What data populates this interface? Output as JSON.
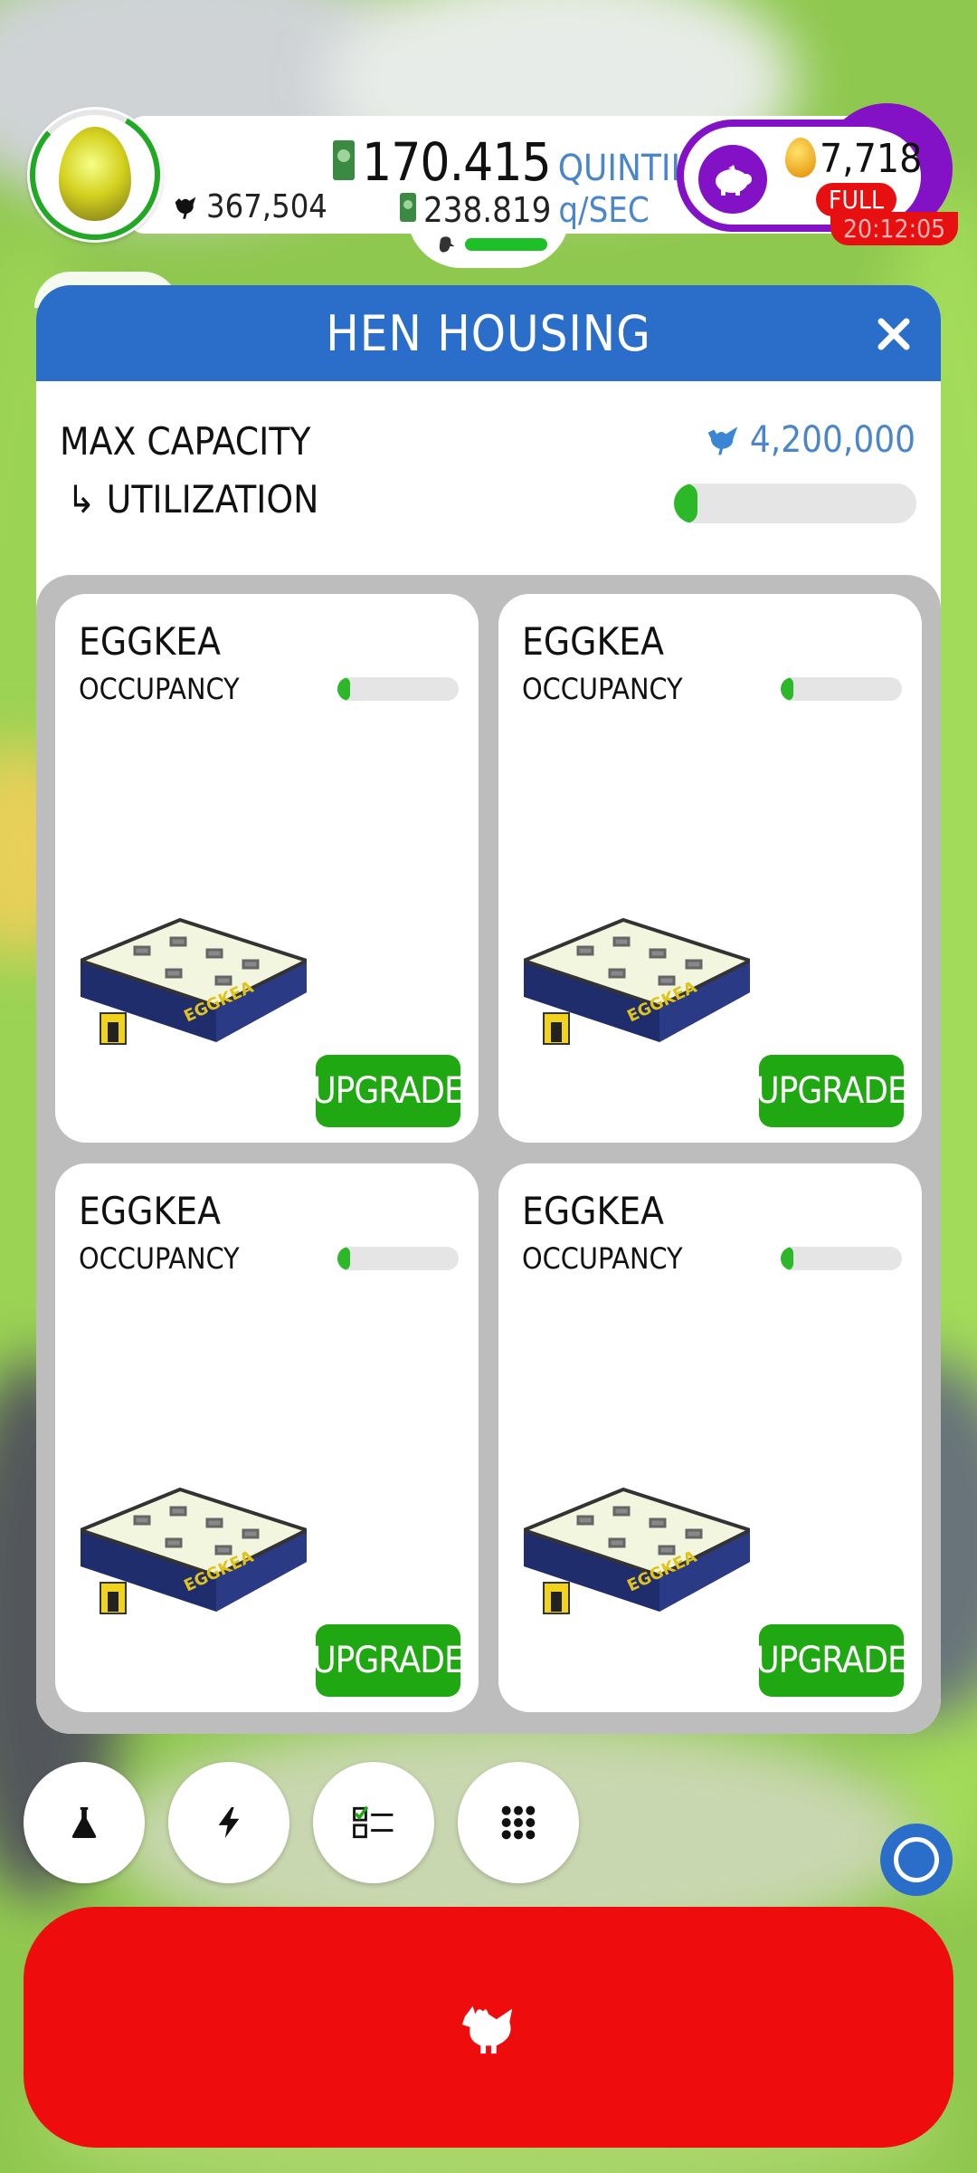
{
  "hud": {
    "chicken_count": "367,504",
    "money_amount": "170.415",
    "money_unit": "QUINTILLION",
    "rate_amount": "238.819",
    "rate_unit": "q/SEC",
    "golden_eggs": "7,718",
    "piggy_status": "FULL",
    "timer": "20:12:05"
  },
  "panel": {
    "title": "HEN HOUSING",
    "max_capacity_label": "MAX CAPACITY",
    "utilization_label": "↳ UTILIZATION",
    "max_capacity_value": "4,200,000",
    "utilization_fraction": 0.06
  },
  "houses": [
    {
      "name": "EGGKEA",
      "occupancy_label": "OCCUPANCY",
      "occupancy_fraction": 0.06,
      "upgrade_label": "UPGRADE"
    },
    {
      "name": "EGGKEA",
      "occupancy_label": "OCCUPANCY",
      "occupancy_fraction": 0.06,
      "upgrade_label": "UPGRADE"
    },
    {
      "name": "EGGKEA",
      "occupancy_label": "OCCUPANCY",
      "occupancy_fraction": 0.06,
      "upgrade_label": "UPGRADE"
    },
    {
      "name": "EGGKEA",
      "occupancy_label": "OCCUPANCY",
      "occupancy_fraction": 0.06,
      "upgrade_label": "UPGRADE"
    }
  ],
  "building_sign": "EGGKEA",
  "bottom_buttons": [
    {
      "icon": "flask-icon"
    },
    {
      "icon": "lightning-icon"
    },
    {
      "icon": "checklist-icon"
    },
    {
      "icon": "grid-menu-icon"
    }
  ],
  "colors": {
    "header_blue": "#2b6ec9",
    "upgrade_green": "#1fa812",
    "hatch_red": "#ef0c0c",
    "piggy_purple": "#8311c6",
    "accent_blue_text": "#4a86c8"
  }
}
